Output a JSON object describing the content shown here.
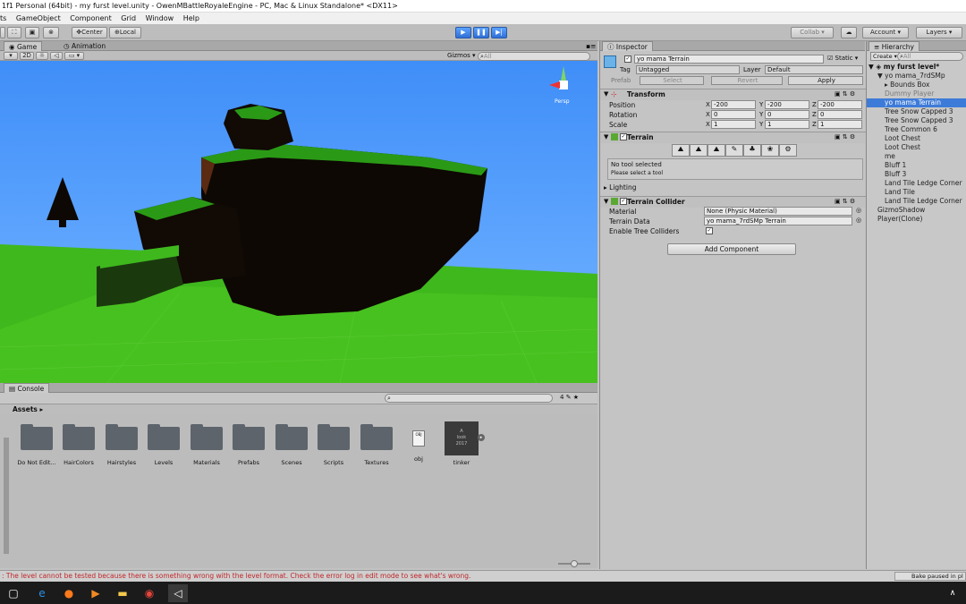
{
  "window": {
    "title": "1f1 Personal (64bit) - my furst level.unity - OwenMBattleRoyaleEngine - PC, Mac & Linux Standalone* <DX11>"
  },
  "menu": [
    "ts",
    "GameObject",
    "Component",
    "Grid",
    "Window",
    "Help"
  ],
  "toolbar": {
    "center_label": "Center",
    "local_label": "Local",
    "collab_label": "Collab",
    "account_label": "Account",
    "layers_label": "Layers"
  },
  "scene": {
    "tab_game": "Game",
    "tab_animation": "Animation",
    "mode_2d": "2D",
    "gizmos_label": "Gizmos",
    "search_placeholder": "All",
    "persp_label": "Persp",
    "colors": {
      "sky": "#4c97ff",
      "grass": "#3fb81e",
      "rock": "#0d0803"
    }
  },
  "console": {
    "tab_label": "Console"
  },
  "project": {
    "assets_label": "Assets",
    "count_label": "4",
    "items": [
      {
        "label": "Do Not Edit..."
      },
      {
        "label": "HairColors"
      },
      {
        "label": "Hairstyles"
      },
      {
        "label": "Levels"
      },
      {
        "label": "Materials"
      },
      {
        "label": "Prefabs"
      },
      {
        "label": "Scenes"
      },
      {
        "label": "Scripts"
      },
      {
        "label": "Textures"
      },
      {
        "label": "obj"
      },
      {
        "label": "tinker"
      }
    ],
    "tinker_thumb_text": "A\nlook\n2017"
  },
  "status": {
    "error_text": ": The level cannot be tested because there is something wrong with the level format. Check the error log in edit mode to see what's wrong.",
    "bake_text": "Bake paused in pl"
  },
  "inspector": {
    "tab_label": "Inspector",
    "object_name": "yo mama Terrain",
    "static_label": "Static",
    "tag_label": "Tag",
    "tag_value": "Untagged",
    "layer_label": "Layer",
    "layer_value": "Default",
    "prefab_label": "Prefab",
    "select_label": "Select",
    "revert_label": "Revert",
    "apply_label": "Apply",
    "transform": {
      "title": "Transform",
      "position_label": "Position",
      "rotation_label": "Rotation",
      "scale_label": "Scale",
      "position": {
        "x": "-200",
        "y": "-200",
        "z": "-200"
      },
      "rotation": {
        "x": "0",
        "y": "0",
        "z": "0"
      },
      "scale": {
        "x": "1",
        "y": "1",
        "z": "1"
      }
    },
    "terrain": {
      "title": "Terrain",
      "no_tool": "No tool selected",
      "please_select": "Please select a tool",
      "lighting_label": "Lighting"
    },
    "collider": {
      "title": "Terrain Collider",
      "material_label": "Material",
      "material_value": "None (Physic Material)",
      "data_label": "Terrain Data",
      "data_value": "yo mama_7rdSMp Terrain",
      "trees_label": "Enable Tree Colliders"
    },
    "add_component_label": "Add Component"
  },
  "hierarchy": {
    "tab_label": "Hierarchy",
    "create_label": "Create",
    "search_placeholder": "All",
    "scene_name": "my furst level*",
    "items": [
      {
        "label": "yo mama_7rdSMp",
        "indent": 1,
        "color": "#222"
      },
      {
        "label": "Bounds Box",
        "indent": 2,
        "color": "#222"
      },
      {
        "label": "Dummy Player",
        "indent": 2,
        "color": "#7a7a7a"
      },
      {
        "label": "yo mama Terrain",
        "indent": 2,
        "color": "#ffffff"
      },
      {
        "label": "Tree Snow Capped 3",
        "indent": 2,
        "color": "#222"
      },
      {
        "label": "Tree Snow Capped 3",
        "indent": 2,
        "color": "#222"
      },
      {
        "label": "Tree Common 6",
        "indent": 2,
        "color": "#222"
      },
      {
        "label": "Loot Chest",
        "indent": 2,
        "color": "#222"
      },
      {
        "label": "Loot Chest",
        "indent": 2,
        "color": "#222"
      },
      {
        "label": "me",
        "indent": 2,
        "color": "#222"
      },
      {
        "label": "Bluff 1",
        "indent": 2,
        "color": "#222"
      },
      {
        "label": "Bluff 3",
        "indent": 2,
        "color": "#222"
      },
      {
        "label": "Land Tile Ledge Corner",
        "indent": 2,
        "color": "#222"
      },
      {
        "label": "Land Tile",
        "indent": 2,
        "color": "#222"
      },
      {
        "label": "Land Tile Ledge Corner",
        "indent": 2,
        "color": "#222"
      },
      {
        "label": "GizmoShadow",
        "indent": 1,
        "color": "#222"
      },
      {
        "label": "Player(Clone)",
        "indent": 1,
        "color": "#222"
      }
    ]
  }
}
